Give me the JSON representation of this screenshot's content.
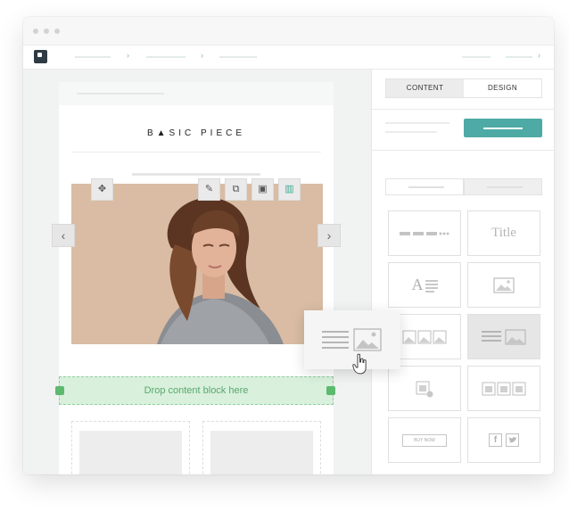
{
  "editor": {
    "brand_text": "B▲SIC PIECE",
    "drop_zone_label": "Drop content block here"
  },
  "hero_toolbar": {
    "move_icon": "move-icon",
    "edit_icon": "edit-icon",
    "duplicate_icon": "duplicate-icon",
    "save_icon": "save-icon",
    "delete_icon": "trash-icon"
  },
  "panel": {
    "tabs": [
      {
        "label": "CONTENT"
      },
      {
        "label": "DESIGN"
      }
    ],
    "blocks": [
      {
        "name": "divider-block",
        "icon": "divider-icon"
      },
      {
        "name": "title-block",
        "label": "Title"
      },
      {
        "name": "text-block",
        "label": "A"
      },
      {
        "name": "image-block",
        "icon": "image-icon"
      },
      {
        "name": "gallery-block",
        "icon": "gallery-icon"
      },
      {
        "name": "text-image-block",
        "icon": "text-image-icon"
      },
      {
        "name": "product-block",
        "icon": "product-icon"
      },
      {
        "name": "products-row-block",
        "icon": "products-icon"
      },
      {
        "name": "button-block",
        "label": "BUY NOW"
      },
      {
        "name": "social-block",
        "label": "f"
      }
    ]
  },
  "colors": {
    "accent_teal": "#4eaaa5",
    "drop_zone_green": "#d8f0dc",
    "drop_marker_green": "#5cba6f"
  }
}
